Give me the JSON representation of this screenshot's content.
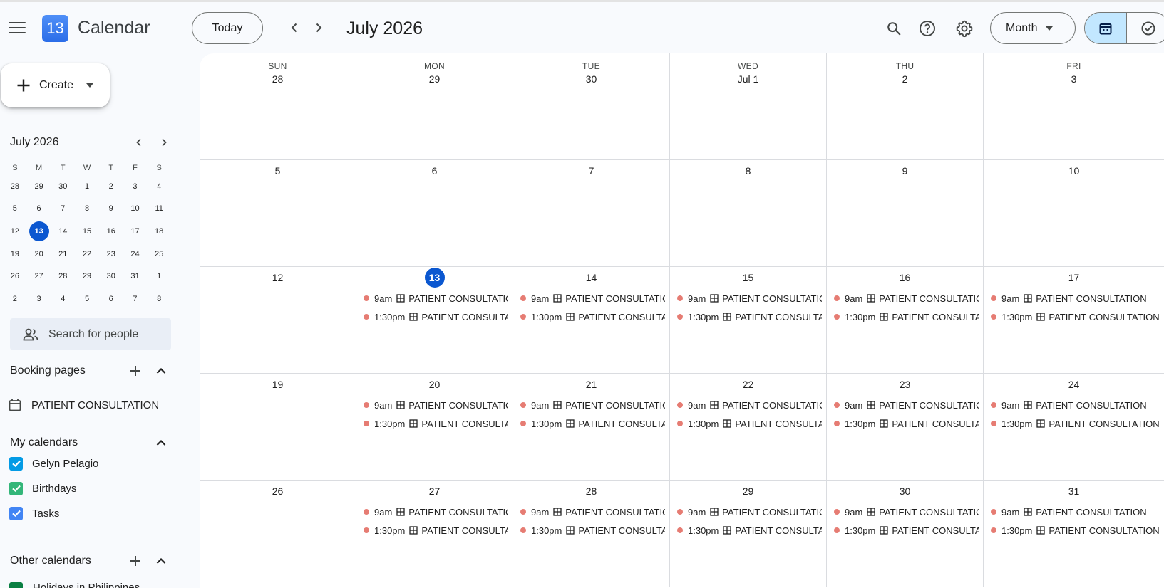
{
  "header": {
    "app_title": "Calendar",
    "logo_number": "13",
    "today_label": "Today",
    "month_title": "July 2026",
    "view_label": "Month"
  },
  "sidebar": {
    "create_label": "Create",
    "mini_month_title": "July 2026",
    "mini_dow": [
      "S",
      "M",
      "T",
      "W",
      "T",
      "F",
      "S"
    ],
    "mini_weeks": [
      [
        "28",
        "29",
        "30",
        "1",
        "2",
        "3",
        "4"
      ],
      [
        "5",
        "6",
        "7",
        "8",
        "9",
        "10",
        "11"
      ],
      [
        "12",
        "13",
        "14",
        "15",
        "16",
        "17",
        "18"
      ],
      [
        "19",
        "20",
        "21",
        "22",
        "23",
        "24",
        "25"
      ],
      [
        "26",
        "27",
        "28",
        "29",
        "30",
        "31",
        "1"
      ],
      [
        "2",
        "3",
        "4",
        "5",
        "6",
        "7",
        "8"
      ]
    ],
    "search_people_placeholder": "Search for people",
    "booking_pages_label": "Booking pages",
    "booking_item_label": "PATIENT CONSULTATION",
    "my_calendars_label": "My calendars",
    "calendars": [
      {
        "label": "Gelyn Pelagio",
        "color": "#039be5"
      },
      {
        "label": "Birthdays",
        "color": "#33b679"
      },
      {
        "label": "Tasks",
        "color": "#4285f4"
      }
    ],
    "other_calendars_label": "Other calendars",
    "other_calendar_partial": "Holidays in Philippines"
  },
  "grid": {
    "dow": [
      "SUN",
      "MON",
      "TUE",
      "WED",
      "THU",
      "FRI"
    ],
    "weeks": [
      [
        "28",
        "29",
        "30",
        "Jul 1",
        "2",
        "3"
      ],
      [
        "5",
        "6",
        "7",
        "8",
        "9",
        "10"
      ],
      [
        "12",
        "13",
        "14",
        "15",
        "16",
        "17"
      ],
      [
        "19",
        "20",
        "21",
        "22",
        "23",
        "24"
      ],
      [
        "26",
        "27",
        "28",
        "29",
        "30",
        "31"
      ]
    ],
    "today": "13",
    "event_color": "#e67c73",
    "events": [
      {
        "time": "9am",
        "title": "PATIENT CONSULTATION"
      },
      {
        "time": "1:30pm",
        "title": "PATIENT CONSULTATION"
      }
    ]
  },
  "colors": {
    "accent": "#0b57d0",
    "active_toggle": "#c2e7ff"
  }
}
